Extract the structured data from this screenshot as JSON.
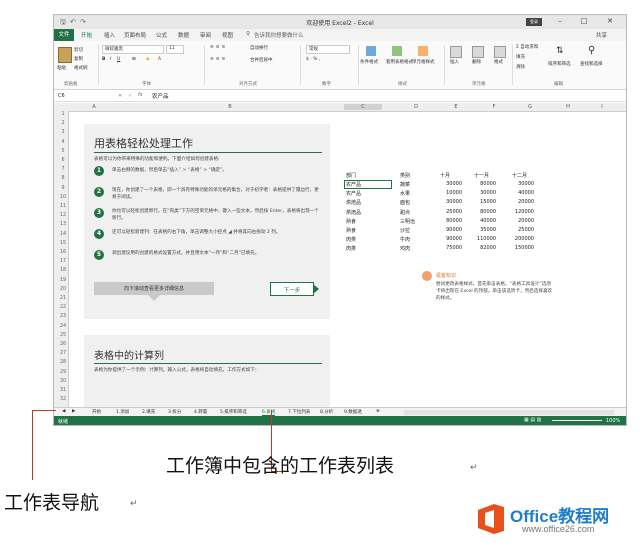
{
  "window": {
    "title": "欢迎使用 Excel2 - Excel",
    "login": "登录",
    "share": "共享"
  },
  "ribbon_tabs": [
    "文件",
    "开始",
    "插入",
    "页面布局",
    "公式",
    "数据",
    "审阅",
    "视图"
  ],
  "tell_me": "告诉我你想要做什么",
  "clipboard": {
    "cut": "剪切",
    "copy": "复制",
    "format_painter": "格式刷",
    "paste": "粘贴",
    "group": "剪贴板"
  },
  "font": {
    "name": "微软雅黑",
    "size": "11",
    "group": "字体"
  },
  "alignment": {
    "wrap": "自动换行",
    "merge": "合并后居中",
    "group": "对齐方式"
  },
  "number": {
    "format": "常规",
    "group": "数字"
  },
  "styles": {
    "cond": "条件格式",
    "table": "套用表格格式",
    "cell": "单元格样式",
    "group": "样式"
  },
  "cells": {
    "insert": "插入",
    "delete": "删除",
    "format": "格式",
    "group": "单元格"
  },
  "editing": {
    "autosum": "自动求和",
    "fill": "填充",
    "clear": "清除",
    "sort": "排序和筛选",
    "find": "查找和选择",
    "group": "编辑"
  },
  "formula_bar": {
    "namebox": "C6",
    "fx": "fx",
    "content": "农产品"
  },
  "columns": [
    "A",
    "B",
    "C",
    "D",
    "E",
    "F",
    "G",
    "H",
    "I"
  ],
  "rows": [
    "1",
    "2",
    "3",
    "4",
    "5",
    "6",
    "7",
    "8",
    "9",
    "10",
    "11",
    "12",
    "13",
    "14",
    "15",
    "16",
    "17",
    "18",
    "19",
    "20",
    "21",
    "22",
    "23",
    "24",
    "25",
    "26",
    "27",
    "28",
    "29",
    "30",
    "31",
    "32"
  ],
  "tutorial": {
    "heading": "用表格轻松处理工作",
    "intro": "表格可以为你带来特殊的功能和便利。下面介绍如何创建表格:",
    "steps": [
      {
        "n": "1",
        "text": "单击右侧的数据，然后单击“插入” > “表格” > “确定”。"
      },
      {
        "n": "2",
        "text": "现在，你创建了一个表格，即一个具有特殊功能的单元格的集合。对于初学者：表格提供了镶边行，更易于阅读。"
      },
      {
        "n": "3",
        "text": "你也可以轻松创建新行。在“肉类”下方的空单元格中，键入一些文本，然后按 Enter，表格将出现一个新行。"
      },
      {
        "n": "4",
        "text": "还可以轻松新建列：在表格的右下角，单击调整大小控点 ◢ 并将其向右拖动 2 列。"
      },
      {
        "n": "5",
        "text": "调出建议用的创建的格式设置方式，并且用文本“一月”和“二月”已填充。"
      }
    ],
    "scroll_button": "向下滚动查看更多详细信息",
    "next_button": "下一步",
    "heading2": "表格中的计算列",
    "intro2": "表格为你提供了一个示例：计算列。输入公式，表格将自动填充。工作方式如下："
  },
  "table": {
    "headers": [
      "部门",
      "类别",
      "十月",
      "十一月",
      "十二月"
    ],
    "rows": [
      [
        "农产品",
        "蔬菜",
        "30000",
        "80000",
        "30000"
      ],
      [
        "农产品",
        "水果",
        "10000",
        "30000",
        "40000"
      ],
      [
        "烘焙品",
        "面包",
        "30000",
        "15000",
        "20000"
      ],
      [
        "烘焙品",
        "甜点",
        "25000",
        "80000",
        "120000"
      ],
      [
        "熟食",
        "三明治",
        "80000",
        "40000",
        "20000"
      ],
      [
        "熟食",
        "沙拉",
        "90000",
        "35000",
        "25000"
      ],
      [
        "肉类",
        "牛肉",
        "90000",
        "110000",
        "200000"
      ],
      [
        "肉类",
        "鸡肉",
        "75000",
        "82000",
        "150000"
      ]
    ]
  },
  "tip": {
    "title": "极客知识",
    "text": "尝试更改表格样式。首先单击表格，“表格工具设计”选项卡将出现在 Excel 的顶部。单击该选项卡，然后选择喜欢的样式。"
  },
  "sheet_tabs": [
    "开始",
    "1.添加",
    "2.填充",
    "3.拆分",
    "4.转置",
    "5.排序和筛选",
    "6.表格",
    "7.下拉列表",
    "8.分析",
    "9.数据透"
  ],
  "active_sheet": "6.表格",
  "status": {
    "ready": "就绪",
    "zoom": "100%"
  },
  "annotations": {
    "tab_list": "工作簿中包含的工作表列表",
    "nav": "工作表导航",
    "mark": "↵"
  },
  "logo": {
    "office": "Office教程网",
    "url": "www.office26.com"
  },
  "colors": {
    "excel_green": "#217346",
    "logo_orange": "#e8501e",
    "logo_blue": "#1f7ec8"
  }
}
